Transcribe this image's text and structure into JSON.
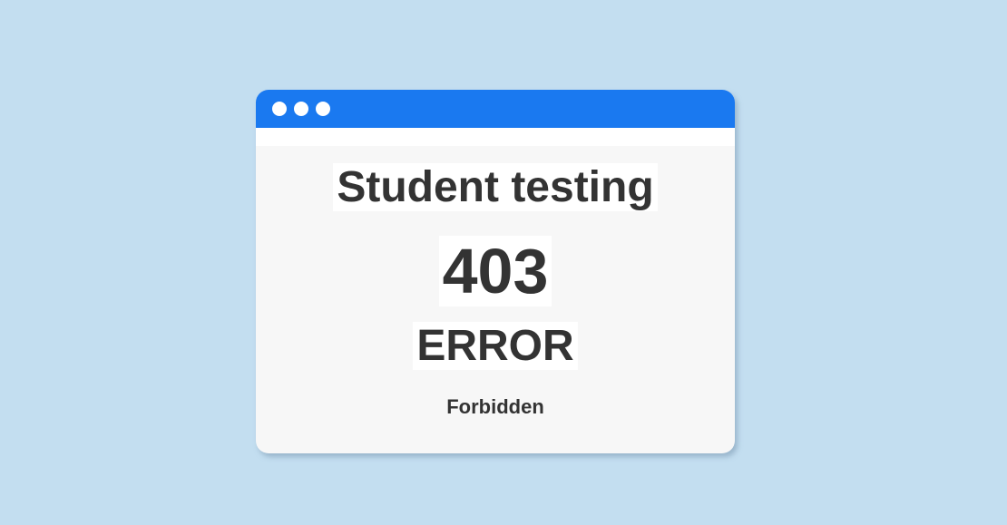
{
  "window": {
    "title_text": "Student testing",
    "status_code": "403",
    "status_word": "ERROR",
    "status_message": "Forbidden"
  },
  "colors": {
    "background": "#c3def0",
    "titlebar": "#1a79f0",
    "text": "#333333"
  }
}
